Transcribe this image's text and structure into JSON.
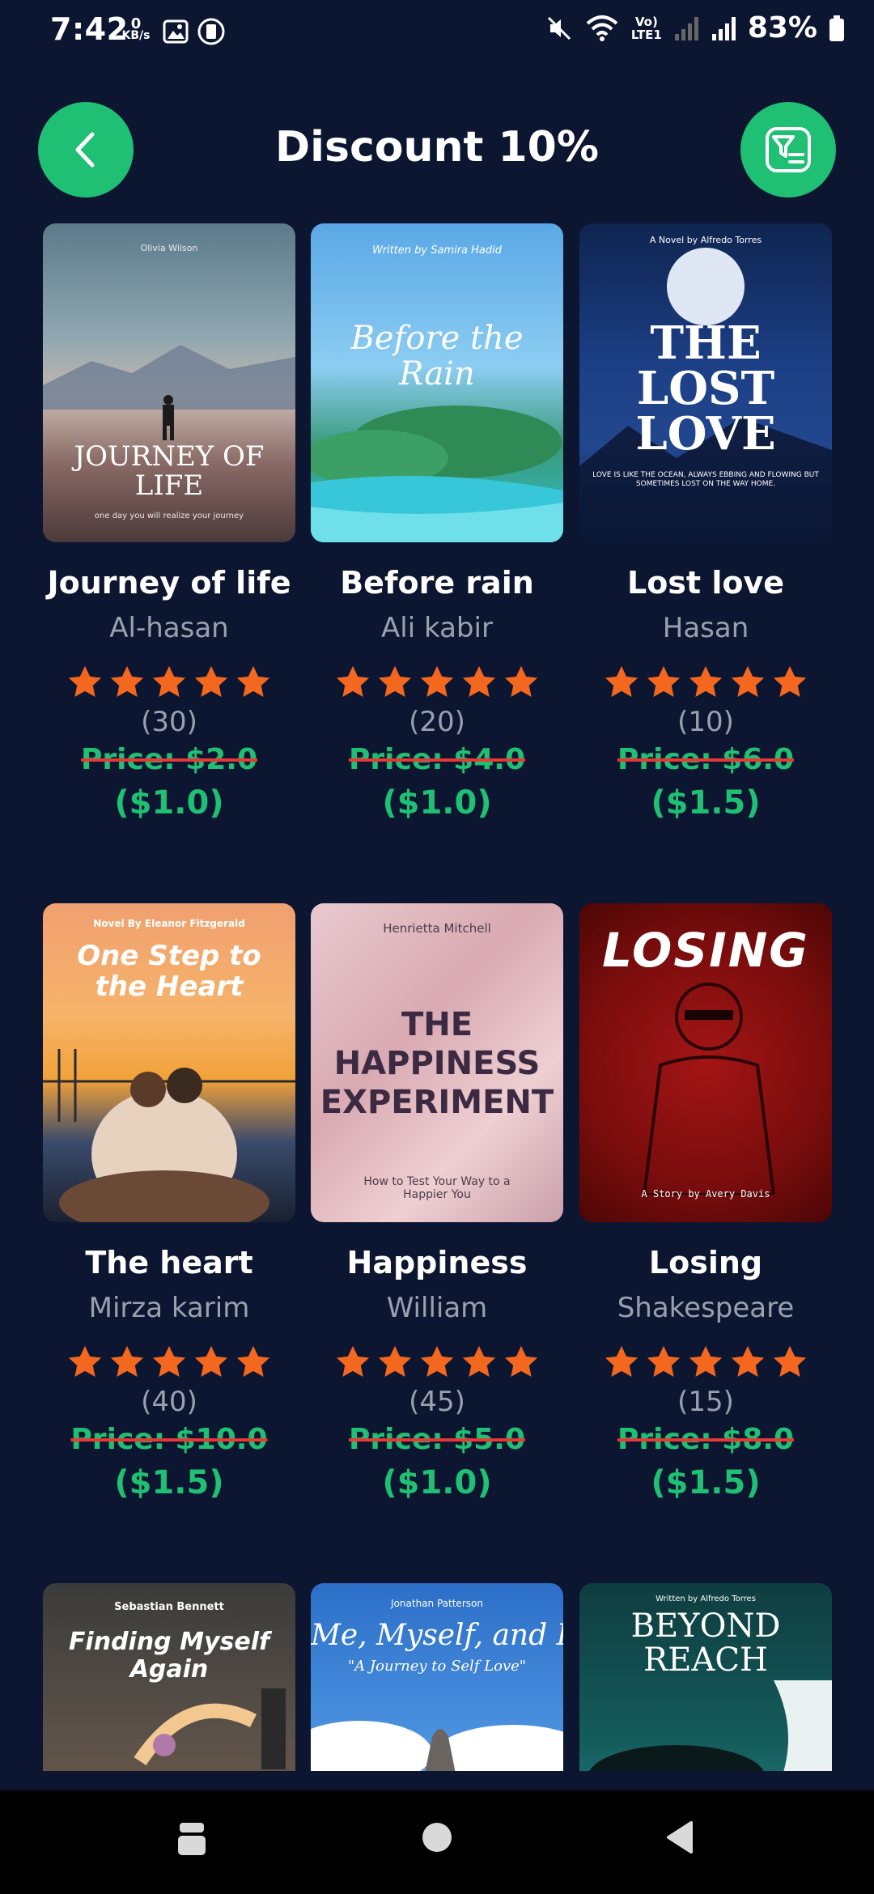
{
  "status": {
    "time": "7:42",
    "kbs_top": "0",
    "kbs_bottom": "KB/s",
    "network_label_top": "Vo)",
    "network_label_bottom": "LTE1",
    "battery": "83%"
  },
  "header": {
    "title": "Discount 10%",
    "back_icon": "chevron-left-icon",
    "filter_icon": "filter-list-icon"
  },
  "colors": {
    "background": "#0c1631",
    "accent": "#1fbf74",
    "star": "#f4671f",
    "strike": "#e53935"
  },
  "books": [
    {
      "title": "Journey of life",
      "author": "Al-hasan",
      "rating": 5,
      "count": "(30)",
      "price": "Price: $2.0",
      "discount": "($1.0)",
      "cover": {
        "top": "Olivia Wilson",
        "main": "JOURNEY OF LIFE",
        "bottom": "one day you will realize your journey"
      }
    },
    {
      "title": "Before rain",
      "author": "Ali kabir",
      "rating": 5,
      "count": "(20)",
      "price": "Price: $4.0",
      "discount": "($1.0)",
      "cover": {
        "top": "Written by Samira Hadid",
        "main": "Before the Rain",
        "bottom": ""
      }
    },
    {
      "title": "Lost love",
      "author": "Hasan",
      "rating": 5,
      "count": "(10)",
      "price": "Price: $6.0",
      "discount": "($1.5)",
      "cover": {
        "top": "A Novel by Alfredo Torres",
        "main": "THE LOST LOVE",
        "bottom": "LOVE IS LIKE THE OCEAN, ALWAYS EBBING AND FLOWING BUT SOMETIMES LOST ON THE WAY HOME."
      }
    },
    {
      "title": "The heart",
      "author": "Mirza karim",
      "rating": 5,
      "count": "(40)",
      "price": "Price: $10.0",
      "discount": "($1.5)",
      "cover": {
        "top": "Novel By Eleanor Fitzgerald",
        "main": "One Step to the Heart",
        "bottom": ""
      }
    },
    {
      "title": "Happiness",
      "author": "William",
      "rating": 5,
      "count": "(45)",
      "price": "Price: $5.0",
      "discount": "($1.0)",
      "cover": {
        "top": "Henrietta Mitchell",
        "main": "THE HAPPINESS EXPERIMENT",
        "bottom": "How to Test Your Way to a Happier You"
      }
    },
    {
      "title": "Losing",
      "author": "Shakespeare",
      "rating": 5,
      "count": "(15)",
      "price": "Price: $8.0",
      "discount": "($1.5)",
      "cover": {
        "top": "",
        "main": "LOSING",
        "bottom": "A Story by Avery Davis"
      }
    },
    {
      "title": "",
      "author": "",
      "rating": 0,
      "count": "",
      "price": "",
      "discount": "",
      "cover": {
        "top": "Sebastian Bennett",
        "main": "Finding Myself Again",
        "bottom": ""
      }
    },
    {
      "title": "",
      "author": "",
      "rating": 0,
      "count": "",
      "price": "",
      "discount": "",
      "cover": {
        "top": "Jonathan Patterson",
        "main": "Me, Myself, and I",
        "bottom": "\"A Journey to Self Love\""
      }
    },
    {
      "title": "",
      "author": "",
      "rating": 0,
      "count": "",
      "price": "",
      "discount": "",
      "cover": {
        "top": "Written by Alfredo Torres",
        "main": "BEYOND REACH",
        "bottom": ""
      }
    }
  ]
}
